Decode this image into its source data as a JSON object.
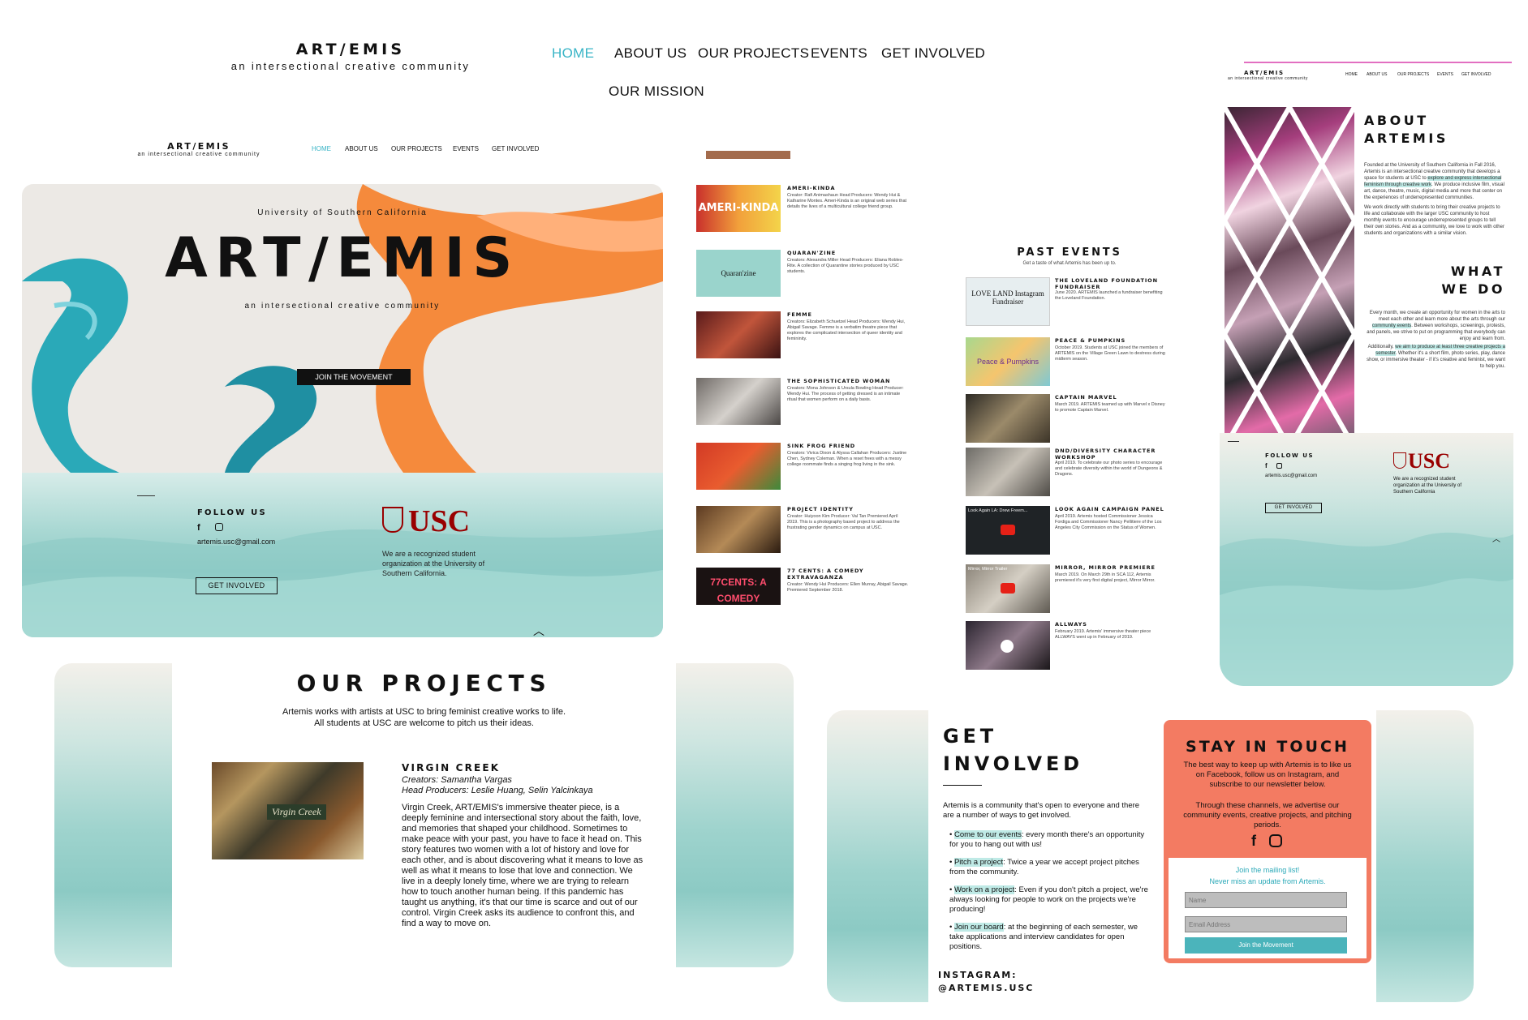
{
  "brand": {
    "title": "ART/EMIS",
    "tagline": "an intersectional creative community"
  },
  "top_nav": [
    {
      "label": "HOME"
    },
    {
      "label": "ABOUT US"
    },
    {
      "label": "OUR PROJECTS"
    },
    {
      "label": "EVENTS"
    },
    {
      "label": "GET INVOLVED"
    },
    {
      "label": "OUR MISSION"
    }
  ],
  "home": {
    "nav": [
      "HOME",
      "ABOUT US",
      "OUR PROJECTS",
      "EVENTS",
      "GET INVOLVED"
    ],
    "hero_kicker": "University of Southern California",
    "hero_title": "ART/EMIS",
    "hero_sub": "an intersectional creative community",
    "cta": "JOIN THE MOVEMENT",
    "follow": "FOLLOW US",
    "email": "artemis.usc@gmail.com",
    "get_involved": "GET INVOLVED",
    "usc": "USC",
    "usc_note": "We are a recognized student organization at the University of Southern California."
  },
  "projects_list": [
    {
      "title": "AMERI-KINDA",
      "thumb": "AMERI-KINDA",
      "text": "Creator: Rafi Animashaun Head Producers: Wendy Hui & Katharine Montes. Ameri-Kinda is an original web series that details the lives of a multicultural college friend group."
    },
    {
      "title": "QUARAN'ZINE",
      "thumb": "Quaran'zine",
      "text": "Creators: Alexandra Miller Head Producers: Eliana Robles-Rite. A collection of Quarantine stories produced by USC students."
    },
    {
      "title": "FEMME",
      "thumb": "",
      "text": "Creators: Elizabeth Schuetzel Head Producers: Wendy Hui, Abigail Savage. Femme is a verbatim theatre piece that explores the complicated intersection of queer identity and femininity."
    },
    {
      "title": "THE SOPHISTICATED WOMAN",
      "thumb": "",
      "text": "Creators: Mona Johnson & Ursula Bowling Head Producer: Wendy Hui. The process of getting dressed is an intimate ritual that women perform on a daily basis."
    },
    {
      "title": "SINK FROG FRIEND",
      "thumb": "",
      "text": "Creators: Vivica Dixon & Alyssa Callahan Producers: Justine Chen, Sydney Coleman. When a reset frees with a messy college roommate finds a singing frog living in the sink."
    },
    {
      "title": "PROJECT IDENTITY",
      "thumb": "",
      "text": "Creator: Huiyoon Kim Producer: Val Tan Premiered April 2019. This is a photography based project to address the frustrating gender dynamics on campus at USC."
    },
    {
      "title": "77 CENTS: A COMEDY EXTRAVAGANZA",
      "thumb": "77CENTS: A COMEDY",
      "text": "Creator: Wendy Hui Producers: Ellen Murray, Abigail Savage. Premiered September 2018."
    }
  ],
  "events": {
    "heading": "PAST EVENTS",
    "sub": "Get a taste of what Artemis has been up to.",
    "items": [
      {
        "title": "THE LOVELAND FOUNDATION FUNDRAISER",
        "thumb": "LOVE LAND Instagram Fundraiser",
        "text": "June 2020. ARTEMIS launched a fundraiser benefiting the Loveland Foundation."
      },
      {
        "title": "PEACE & PUMPKINS",
        "thumb": "Peace & Pumpkins",
        "text": "October 2019. Students at USC joined the members of ARTEMIS on the Village Green Lawn to destress during midterm season."
      },
      {
        "title": "CAPTAIN MARVEL",
        "thumb": "",
        "text": "March 2019. ARTEMIS teamed up with Marvel x Disney to promote Captain Marvel."
      },
      {
        "title": "DND/DIVERSITY CHARACTER WORKSHOP",
        "thumb": "",
        "text": "April 2019. To celebrate our photo series to encourage and celebrate diversity within the world of Dungeons & Dragons."
      },
      {
        "title": "LOOK AGAIN CAMPAIGN PANEL",
        "thumb": "Look Again LA: Drew Freem...",
        "text": "April 2019. Artemis hosted Commissioner Jessica Fordiga and Commissioner Nancy Pellitiere of the Los Angeles City Commission on the Status of Women."
      },
      {
        "title": "MIRROR, MIRROR PREMIERE",
        "thumb": "Mirror, Mirror Trailer",
        "text": "March 2019. On March 29th in SCA 112, Artemis premiered it's very first digital project, Mirror Mirror."
      },
      {
        "title": "ALLWAYS",
        "thumb": "",
        "text": "February 2019. Artemis' immersive theater piece ALLWAYS went up in February of 2019."
      }
    ]
  },
  "about": {
    "nav": [
      "HOME",
      "ABOUT US",
      "OUR PROJECTS",
      "EVENTS",
      "GET INVOLVED"
    ],
    "heading": "ABOUT ARTEMIS",
    "p1_a": "Founded at the University of Southern California in Fall 2016, Artemis is an intersectional creative community that develops a space for students at USC to ",
    "p1_hl": "explore and express intersectional feminism through creative work",
    "p1_b": ". We produce inclusive film, visual art, dance, theatre, music, digital media and more that center on the experiences of underrepresented communities.",
    "p2": "We work directly with students to bring their creative projects to life and collaborate with the larger USC community to host monthly events to encourage underrepresented groups to tell their own stories. And as a community, we love to work with other students and organizations with a similar vision.",
    "what_heading": "WHAT WE DO",
    "p3_a": "Every month, we create an opportunity for women in the arts to meet each other and learn more about the arts through our ",
    "p3_hl": "community events",
    "p3_b": ". Between workshops, screenings, protests, and panels, we strive to put on programming that everybody can enjoy and learn from.",
    "p4_a": "Additionally, ",
    "p4_hl": "we aim to produce at least three creative projects a semester",
    "p4_b": ". Whether it's a short film, photo series, play, dance show, or immersive theater - if it's creative and feminist, we want to help you.",
    "follow": "FOLLOW US",
    "email": "artemis.usc@gmail.com",
    "btn": "GET INVOLVED",
    "usc": "USC",
    "usc_note": "We are a recognized student organization at the University of Southern California"
  },
  "our_projects": {
    "heading": "OUR PROJECTS",
    "intro1": "Artemis works with artists at USC to bring feminist creative works to life.",
    "intro2": "All students at USC are welcome to pitch us their ideas.",
    "item_title": "VIRGIN CREEK",
    "creators": "Creators: Samantha Vargas",
    "producers": "Head Producers: Leslie Huang, Selin Yalcinkaya",
    "thumb_label": "Virgin Creek",
    "body": "Virgin Creek, ART/EMIS's immersive theater piece, is a deeply feminine and intersectional story about the faith, love, and memories that shaped your childhood. Sometimes to make peace with your past, you have to face it head on. This story features two women with a lot of history and love for each other, and is about discovering what it means to love as well as what it means to lose that love and connection. We live in a deeply lonely time, where we are trying to relearn how to touch another human being. If this pandemic has taught us anything, it's that our time is scarce and out of our control. Virgin Creek asks its audience to confront this, and find a way to move on."
  },
  "get_involved": {
    "heading1": "GET",
    "heading2": "INVOLVED",
    "intro": "Artemis is a community that's open to everyone and there are a number of ways to get involved.",
    "items": [
      {
        "hl": "Come to our events",
        "rest": ": every month there's an opportunity for you to hang out with us!"
      },
      {
        "hl": "Pitch a project",
        "rest": ": Twice a year we accept project pitches from the community."
      },
      {
        "hl": "Work on a project",
        "rest": ": Even if you don't pitch a project, we're always looking for people to work on the projects we're producing!"
      },
      {
        "hl": "Join our board",
        "rest": ": at the beginning of each semester, we take applications and interview candidates for open positions."
      }
    ],
    "instagram1": "INSTAGRAM:",
    "instagram2": "@ARTEMIS.USC"
  },
  "stay": {
    "heading": "STAY IN TOUCH",
    "p1": "The best way to keep up with Artemis is to like us on Facebook, follow us on Instagram, and subscribe to our newsletter below.",
    "p2": "Through these channels, we advertise our community events, creative projects, and pitching periods.",
    "form_l1": "Join the mailing list!",
    "form_l2": "Never miss an update from Artemis.",
    "name_ph": "Name",
    "email_ph": "Email Address",
    "submit": "Join the Movement",
    "accent": "#f37b62"
  }
}
